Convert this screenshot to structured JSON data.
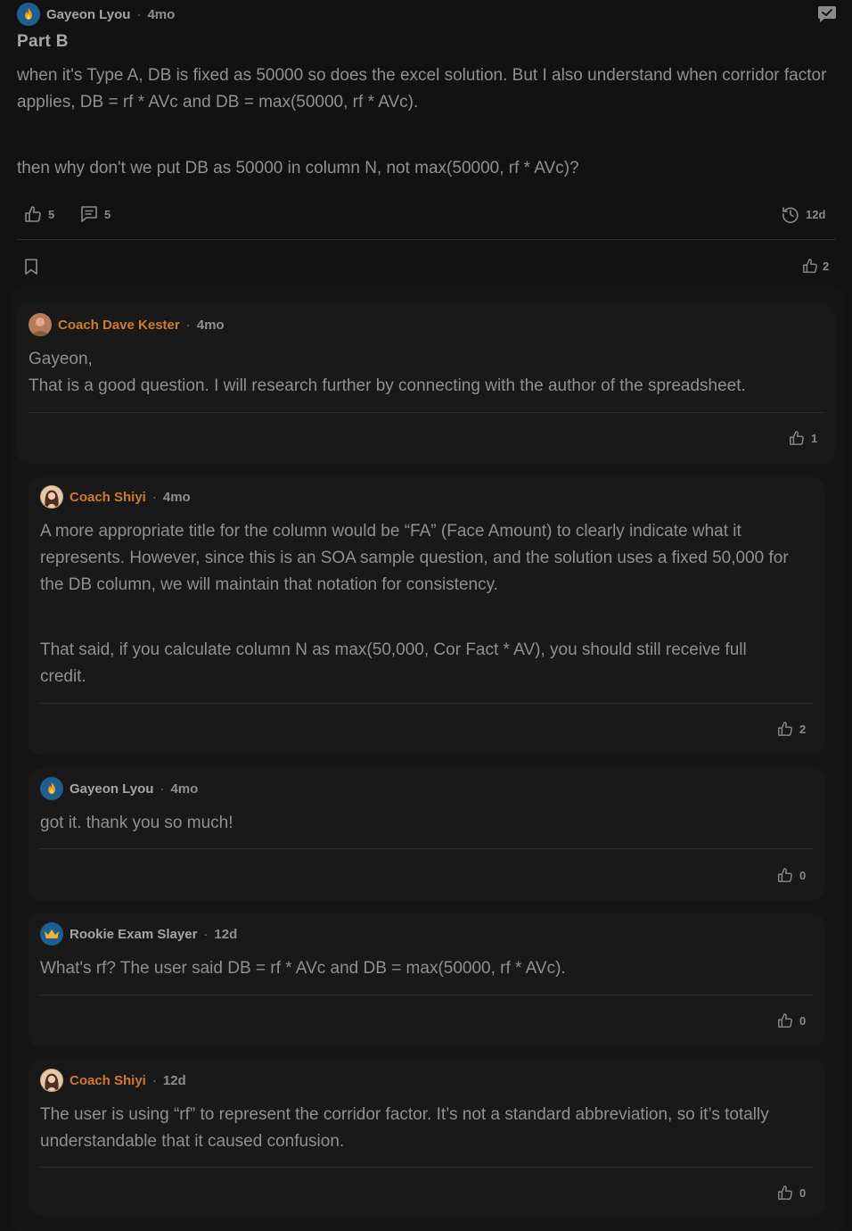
{
  "post": {
    "author": "Gayeon Lyou",
    "time": "4mo",
    "title": "Part B",
    "body_p1": "when it's Type A, DB is fixed as 50000 so does the excel solution. But I also understand when corridor factor applies, DB = rf * AVc and DB = max(50000, rf * AVc).",
    "body_p2": "then why don't we put DB as 50000 in column N, not max(50000, rf * AVc)?",
    "likes": "5",
    "comments": "5",
    "last_activity": "12d",
    "thread_likes": "2",
    "icons": [
      "message-check-icon",
      "thumbs-up-icon",
      "comment-icon",
      "history-icon",
      "bookmark-icon"
    ]
  },
  "replies": [
    {
      "author": "Coach Dave Kester",
      "time": "4mo",
      "lines": [
        "Gayeon,",
        "That is a good question. I will research further by connecting with the author of the spreadsheet."
      ],
      "likes": "1"
    },
    {
      "author": "Coach Shiyi",
      "time": "4mo",
      "p1": "A more appropriate title for the column would be “FA” (Face Amount) to clearly indicate what it represents. However, since this is an SOA sample question, and the solution uses a fixed 50,000 for the DB column, we will maintain that notation for consistency.",
      "p2": "That said, if you calculate column N as max(50,000, Cor Fact * AV), you should still receive full credit.",
      "likes": "2"
    },
    {
      "author": "Gayeon Lyou",
      "time": "4mo",
      "text": "got it. thank you so much!",
      "likes": "0"
    },
    {
      "author": "Rookie Exam Slayer",
      "time": "12d",
      "text": "What's rf? The user said DB = rf * AVc and DB = max(50000, rf * AVc).",
      "likes": "0"
    },
    {
      "author": "Coach Shiyi",
      "time": "12d",
      "text": "The user is using “rf” to represent the corridor factor. It’s not a standard abbreviation, so it’s totally understandable that it caused confusion.",
      "likes": "0"
    }
  ],
  "colors": {
    "background": "#121212",
    "card": "#191919",
    "coach_name": "#d07a2c",
    "user_badge": "#1d5f8f"
  }
}
